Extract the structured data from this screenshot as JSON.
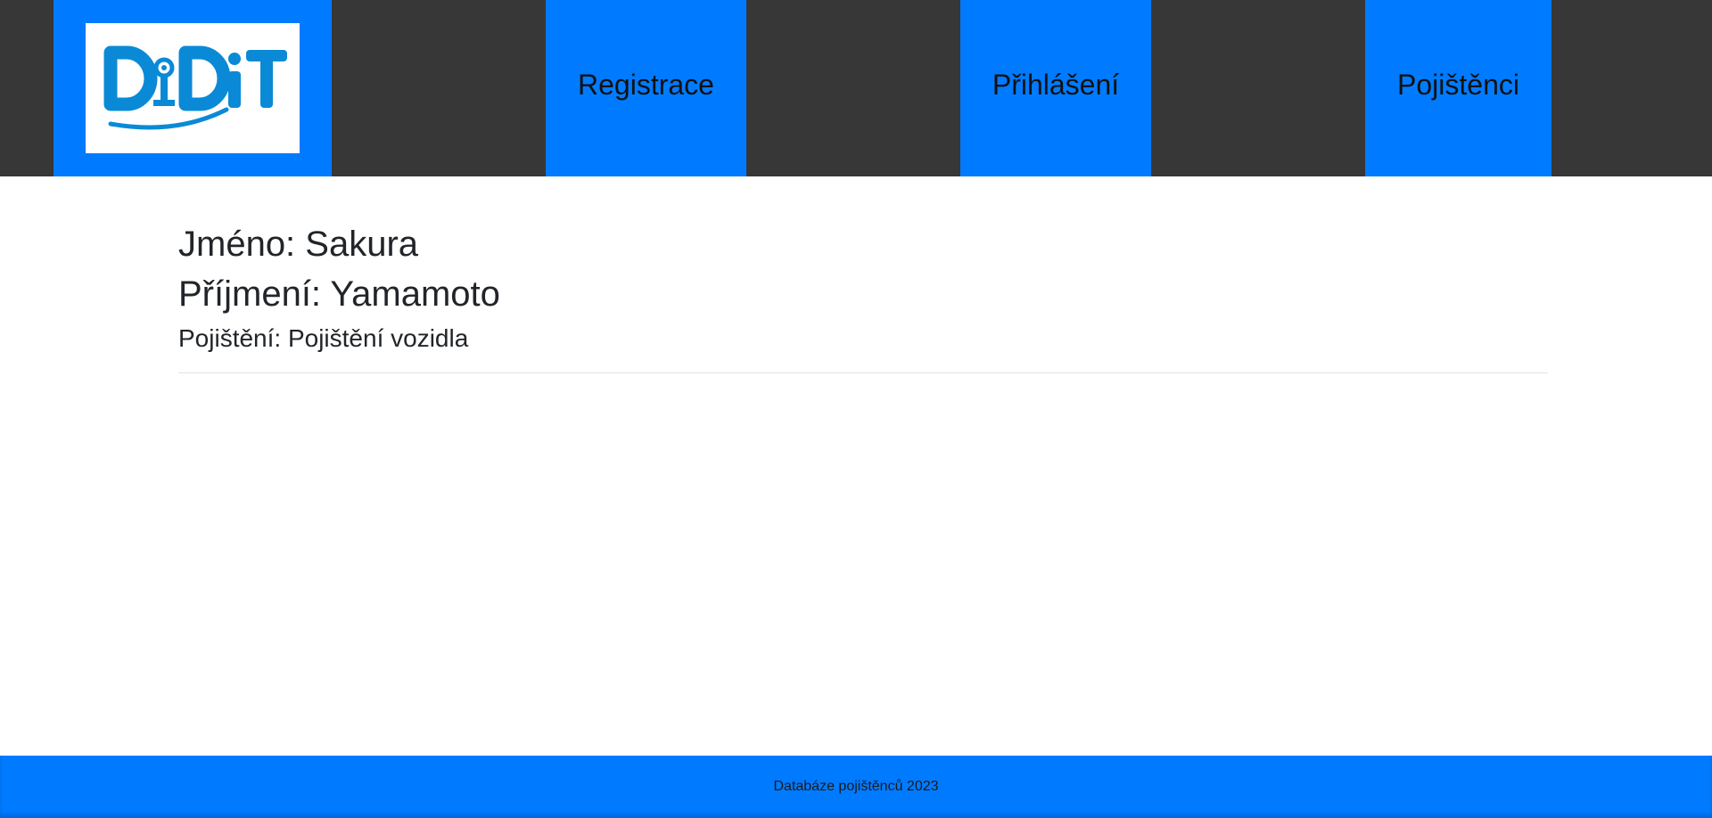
{
  "header": {
    "logo_text": "DDiT",
    "nav": [
      {
        "label": "Registrace"
      },
      {
        "label": "Přihlášení"
      },
      {
        "label": "Pojištěnci"
      }
    ]
  },
  "main": {
    "jmeno": "Jméno: Sakura",
    "prijmeni": "Příjmení: Yamamoto",
    "pojisteni": "Pojištění: Pojištění vozidla"
  },
  "footer": {
    "text": "Databáze pojištěnců 2023"
  },
  "colors": {
    "header_bg": "#373737",
    "accent": "#007bff",
    "logo_blue": "#0a8ad6",
    "page_bg": "#ffffff"
  },
  "icons": {
    "logo": "ddit-logo"
  }
}
